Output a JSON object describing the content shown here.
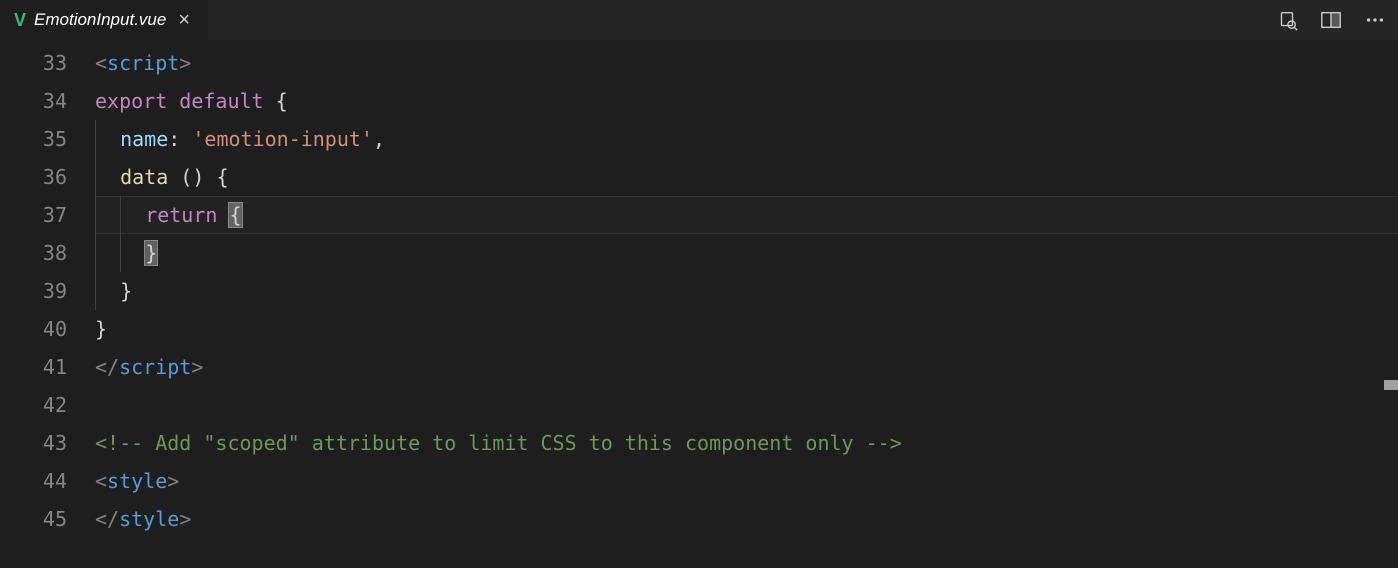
{
  "tab": {
    "filename": "EmotionInput.vue",
    "file_icon": "V",
    "close_glyph": "×"
  },
  "gutter": {
    "lines": [
      "33",
      "34",
      "35",
      "36",
      "37",
      "38",
      "39",
      "40",
      "41",
      "42",
      "43",
      "44",
      "45"
    ]
  },
  "code": {
    "l33": {
      "open": "<",
      "tag": "script",
      "close": ">"
    },
    "l34": {
      "export": "export",
      "default": "default",
      "brace": " {"
    },
    "l35": {
      "name": "name",
      "colon": ": ",
      "value": "'emotion-input'",
      "comma": ","
    },
    "l36": {
      "data": "data",
      "parens": " () ",
      "brace": "{"
    },
    "l37": {
      "return": "return ",
      "brace": "{"
    },
    "l38": {
      "brace": "}"
    },
    "l39": {
      "brace": "}"
    },
    "l40": {
      "brace": "}"
    },
    "l41": {
      "open": "</",
      "tag": "script",
      "close": ">"
    },
    "l43": {
      "comment": "<!-- Add \"scoped\" attribute to limit CSS to this component only -->"
    },
    "l44": {
      "open": "<",
      "tag": "style",
      "close": ">"
    },
    "l45": {
      "open": "</",
      "tag": "style",
      "close": ">"
    }
  }
}
